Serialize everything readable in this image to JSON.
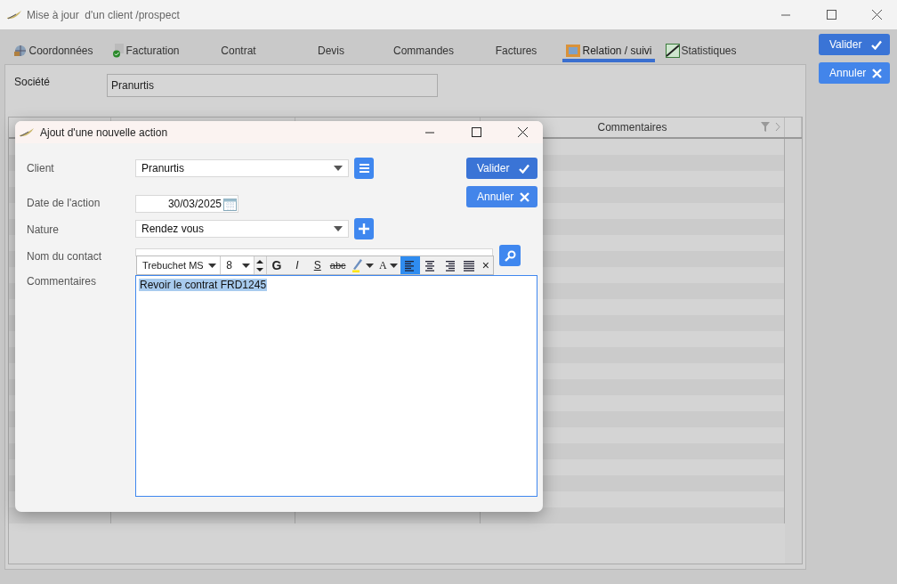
{
  "window": {
    "title": "Mise à jour  d'un client /prospect"
  },
  "tabs": [
    {
      "label": "Coordonnées",
      "selected": false
    },
    {
      "label": "Facturation",
      "selected": false
    },
    {
      "label": "Contrat",
      "selected": false
    },
    {
      "label": "Devis",
      "selected": false
    },
    {
      "label": "Commandes",
      "selected": false
    },
    {
      "label": "Factures",
      "selected": false
    },
    {
      "label": "Relation / suivi",
      "selected": true
    },
    {
      "label": "Statistiques",
      "selected": false
    }
  ],
  "side_buttons": [
    {
      "label": "Valider",
      "kind": "confirm"
    },
    {
      "label": "Annuler",
      "kind": "cancel"
    }
  ],
  "company": {
    "label": "Société",
    "value": "Pranurtis"
  },
  "table": {
    "columns": [
      {
        "label": "Commentaires"
      }
    ]
  },
  "dialog": {
    "title": "Ajout d'une nouvelle action",
    "fields": [
      {
        "kind": "combo",
        "label": "Client",
        "value": "Pranurtis",
        "action": {
          "kind": "list"
        }
      },
      {
        "kind": "date",
        "label": "Date de l'action",
        "value": "30/03/2025"
      },
      {
        "kind": "combo",
        "label": "Nature",
        "value": "Rendez vous",
        "action": {
          "kind": "add"
        }
      },
      {
        "kind": "search",
        "label": "Nom du contact"
      }
    ],
    "buttons": [
      {
        "label": "Valider",
        "kind": "confirm"
      },
      {
        "label": "Annuler",
        "kind": "cancel"
      }
    ],
    "comments": {
      "label": "Commentaires",
      "text": "Revoir le contrat FRD1245",
      "text_selected": true,
      "toolbar": {
        "font": "Trebuchet MS",
        "size": "8",
        "styles": [
          {
            "label": "G",
            "kind": "bold"
          },
          {
            "label": "I",
            "kind": "italic"
          },
          {
            "label": "S",
            "kind": "underline"
          },
          {
            "label": "abc",
            "kind": "strike"
          }
        ],
        "text_color": "A",
        "alignments": [
          {
            "kind": "left",
            "selected": true
          },
          {
            "kind": "center",
            "selected": false
          },
          {
            "kind": "right",
            "selected": false
          },
          {
            "kind": "justify",
            "selected": false
          }
        ],
        "close": "×"
      }
    }
  }
}
